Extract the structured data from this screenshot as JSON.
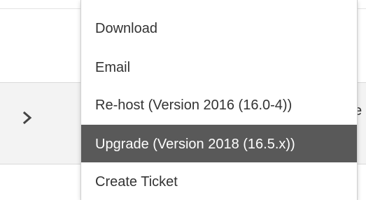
{
  "menu": {
    "items": [
      {
        "label": "Download"
      },
      {
        "label": "Email"
      },
      {
        "label": "Re-host (Version 2016 (16.0-4))"
      },
      {
        "label": "Upgrade (Version 2018 (16.5.x))"
      },
      {
        "label": "Create Ticket"
      }
    ],
    "highlighted_index": 3
  },
  "background": {
    "right_fragment": "e",
    "chevron_icon": "chevron-right-icon"
  },
  "colors": {
    "highlight_bg": "#595959",
    "highlight_text": "#ffffff",
    "text": "#333333",
    "link": "#1a7fc1"
  }
}
